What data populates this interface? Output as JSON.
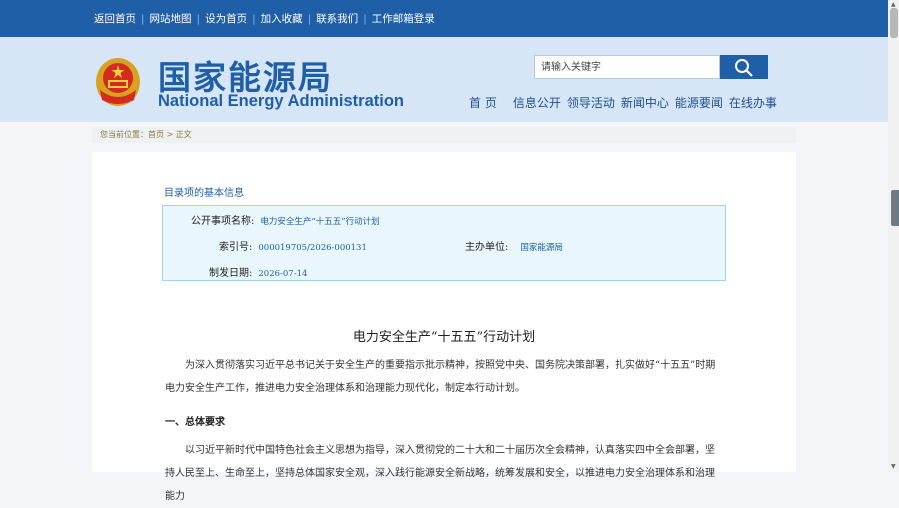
{
  "top_links": [
    "返回首页",
    "网站地图",
    "设为首页",
    "加入收藏",
    "联系我们",
    "工作邮箱登录"
  ],
  "logo": {
    "cn": "国家能源局",
    "en": "National Energy Administration"
  },
  "search": {
    "placeholder": "请输入关键字"
  },
  "nav": [
    "首 页",
    "信息公开",
    "领导活动",
    "新闻中心",
    "能源要闻",
    "在线办事"
  ],
  "breadcrumb": "您当前位置：首页 > 正文",
  "info": {
    "section_label": "目录项的基本信息",
    "name_label": "公开事项名称:",
    "name_value": "电力安全生产“十五五”行动计划",
    "index_label": "索引号:",
    "index_value": "000019705/2026-000131",
    "unit_label": "主办单位:",
    "unit_value": "国家能源局",
    "date_label": "制发日期:",
    "date_value": "2026-07-14"
  },
  "doc": {
    "title": "电力安全生产“十五五”行动计划",
    "para1": "为深入贯彻落实习近平总书记关于安全生产的重要指示批示精神，按照党中央、国务院决策部署，扎实做好“十五五”时期电力安全生产工作，推进电力安全治理体系和治理能力现代化，制定本行动计划。",
    "heading1": "一、总体要求",
    "para2": "以习近平新时代中国特色社会主义思想为指导，深入贯彻党的二十大和二十届历次全会精神，认真落实四中全会部署，坚持人民至上、生命至上，坚持总体国家安全观，深入践行能源安全新战略，统筹发展和安全，以推进电力安全治理体系和治理能力"
  },
  "colors": {
    "primary": "#1f5fa8",
    "header_bg": "#d7e6f6",
    "info_bg": "#e9f7fd"
  }
}
